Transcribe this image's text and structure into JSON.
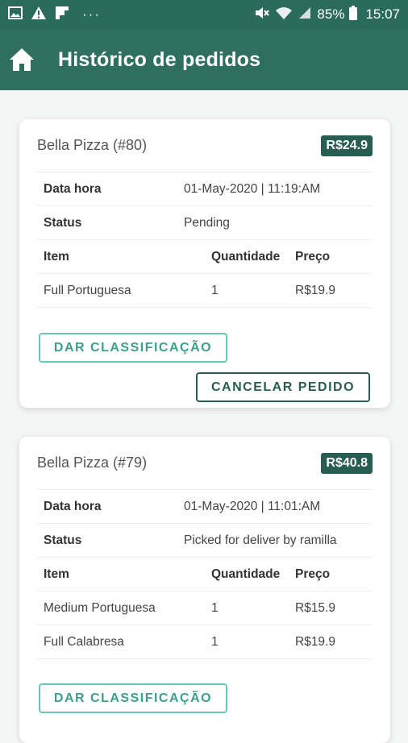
{
  "status_bar": {
    "battery": "85%",
    "time": "15:07",
    "left_icons": [
      "image-icon",
      "warning-icon",
      "flipboard-icon",
      "more-dots-icon"
    ],
    "right_icons": [
      "mute-icon",
      "wifi-icon",
      "signal-icon",
      "battery-icon"
    ]
  },
  "app_bar": {
    "title": "Histórico de pedidos",
    "icon": "home-icon"
  },
  "colors": {
    "primary": "#2e6f61",
    "badge": "#275d52",
    "outline_accent": "#6fc6b8"
  },
  "orders": [
    {
      "title": "Bella Pizza (#80)",
      "total": "R$24.9",
      "date_label": "Data hora",
      "date_value": "01-May-2020 | 11:19:AM",
      "status_label": "Status",
      "status_value": "Pending",
      "headers": {
        "item": "Item",
        "qty": "Quantidade",
        "price": "Preço"
      },
      "items": [
        {
          "name": "Full Portuguesa",
          "qty": "1",
          "price": "R$19.9"
        }
      ],
      "rate_button": "DAR CLASSIFICAÇÃO",
      "cancel_button": "CANCELAR PEDIDO"
    },
    {
      "title": "Bella Pizza (#79)",
      "total": "R$40.8",
      "date_label": "Data hora",
      "date_value": "01-May-2020 | 11:01:AM",
      "status_label": "Status",
      "status_value": "Picked for deliver by ramilla",
      "headers": {
        "item": "Item",
        "qty": "Quantidade",
        "price": "Preço"
      },
      "items": [
        {
          "name": "Medium Portuguesa",
          "qty": "1",
          "price": "R$15.9"
        },
        {
          "name": "Full Calabresa",
          "qty": "1",
          "price": "R$19.9"
        }
      ],
      "rate_button": "DAR CLASSIFICAÇÃO"
    }
  ]
}
